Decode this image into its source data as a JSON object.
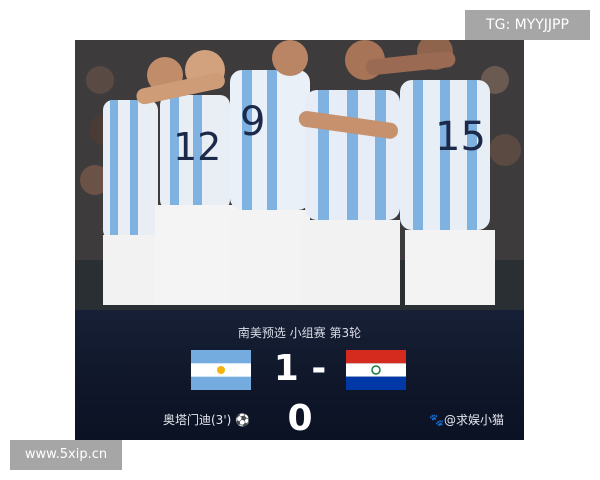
{
  "watermarks": {
    "telegram": "TG: MYYJJPP",
    "site": "www.5xip.cn"
  },
  "match": {
    "competition": "南美预选 小组赛 第3轮",
    "score": "1 - 0",
    "home_team_flag": "argentina-flag",
    "away_team_flag": "paraguay-flag",
    "scorer": "奥塔门迪(3') ⚽",
    "source": "🐾@求娱小猫"
  },
  "colors": {
    "panel_bg": "#0f1629",
    "argentina_blue": "#74acdf",
    "paraguay_red": "#d52b1e",
    "paraguay_blue": "#0038a8"
  }
}
